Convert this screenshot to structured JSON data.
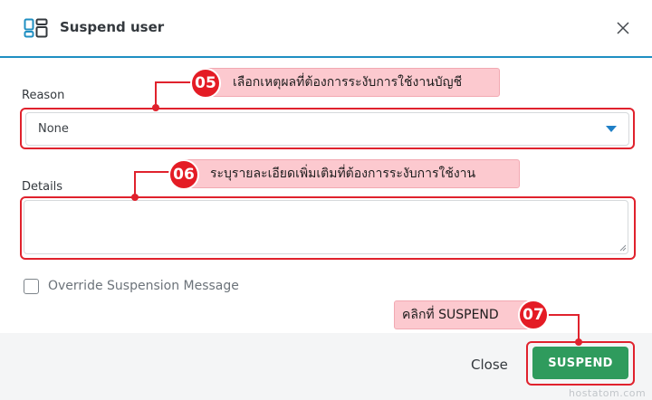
{
  "dialog": {
    "title": "Suspend user",
    "icon": "dashboard-icon",
    "close_icon": "close-icon"
  },
  "form": {
    "reason_label": "Reason",
    "reason_value": "None",
    "details_label": "Details",
    "details_value": "",
    "override_label": "Override Suspension Message",
    "override_checked": false
  },
  "footer": {
    "close_label": "Close",
    "suspend_label": "SUSPEND"
  },
  "annotations": [
    {
      "number": "05",
      "text": "เลือกเหตุผลที่ต้องการระงับการใช้งานบัญชี"
    },
    {
      "number": "06",
      "text": "ระบุรายละเอียดเพิ่มเติมที่ต้องการระงับการใช้งาน"
    },
    {
      "number": "07",
      "text": "คลิกที่ SUSPEND"
    }
  ],
  "watermark": "hostatom.com",
  "colors": {
    "accent": "#1f8fc2",
    "primary_button": "#2f9b5d",
    "highlight": "#e0222d",
    "callout_bg": "#fcc9cf"
  }
}
